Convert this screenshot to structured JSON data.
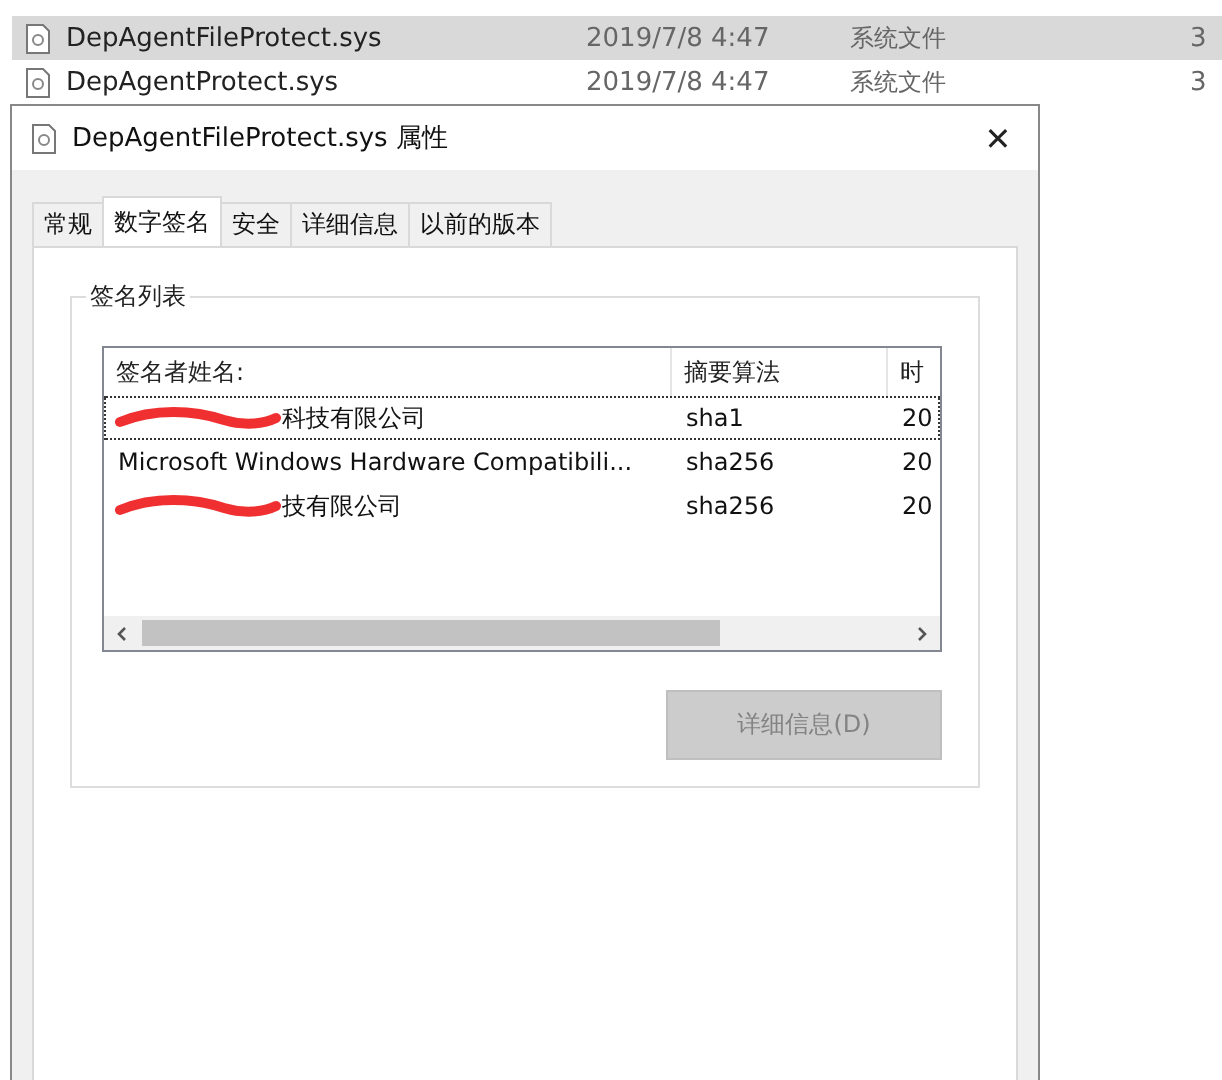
{
  "explorer": {
    "files": [
      {
        "name": "DepAgentFileProtect.sys",
        "date": "2019/7/8 4:47",
        "type": "系统文件",
        "column_4": "3",
        "selected": true
      },
      {
        "name": "DepAgentProtect.sys",
        "date": "2019/7/8 4:47",
        "type": "系统文件",
        "column_4": "3",
        "selected": false
      }
    ]
  },
  "dialog": {
    "title": "DepAgentFileProtect.sys 属性",
    "close": "✕",
    "tabs": [
      {
        "label": "常规",
        "selected": false
      },
      {
        "label": "数字签名",
        "selected": true
      },
      {
        "label": "安全",
        "selected": false
      },
      {
        "label": "详细信息",
        "selected": false
      },
      {
        "label": "以前的版本",
        "selected": false
      }
    ],
    "group": {
      "title": "签名列表",
      "table": {
        "columns": [
          "签名者姓名:",
          "摘要算法",
          "时"
        ],
        "rows": [
          {
            "cells": [
              "科技有限公司",
              "sha1",
              "20"
            ],
            "redacted": true,
            "focused": true
          },
          {
            "cells": [
              "Microsoft Windows Hardware Compatibili...",
              "sha256",
              "20"
            ],
            "redacted": false,
            "focused": false
          },
          {
            "cells": [
              "技有限公司",
              "sha256",
              "20"
            ],
            "redacted": true,
            "focused": false
          }
        ]
      },
      "button": {
        "label": "详细信息(D)",
        "disabled": true
      }
    }
  }
}
